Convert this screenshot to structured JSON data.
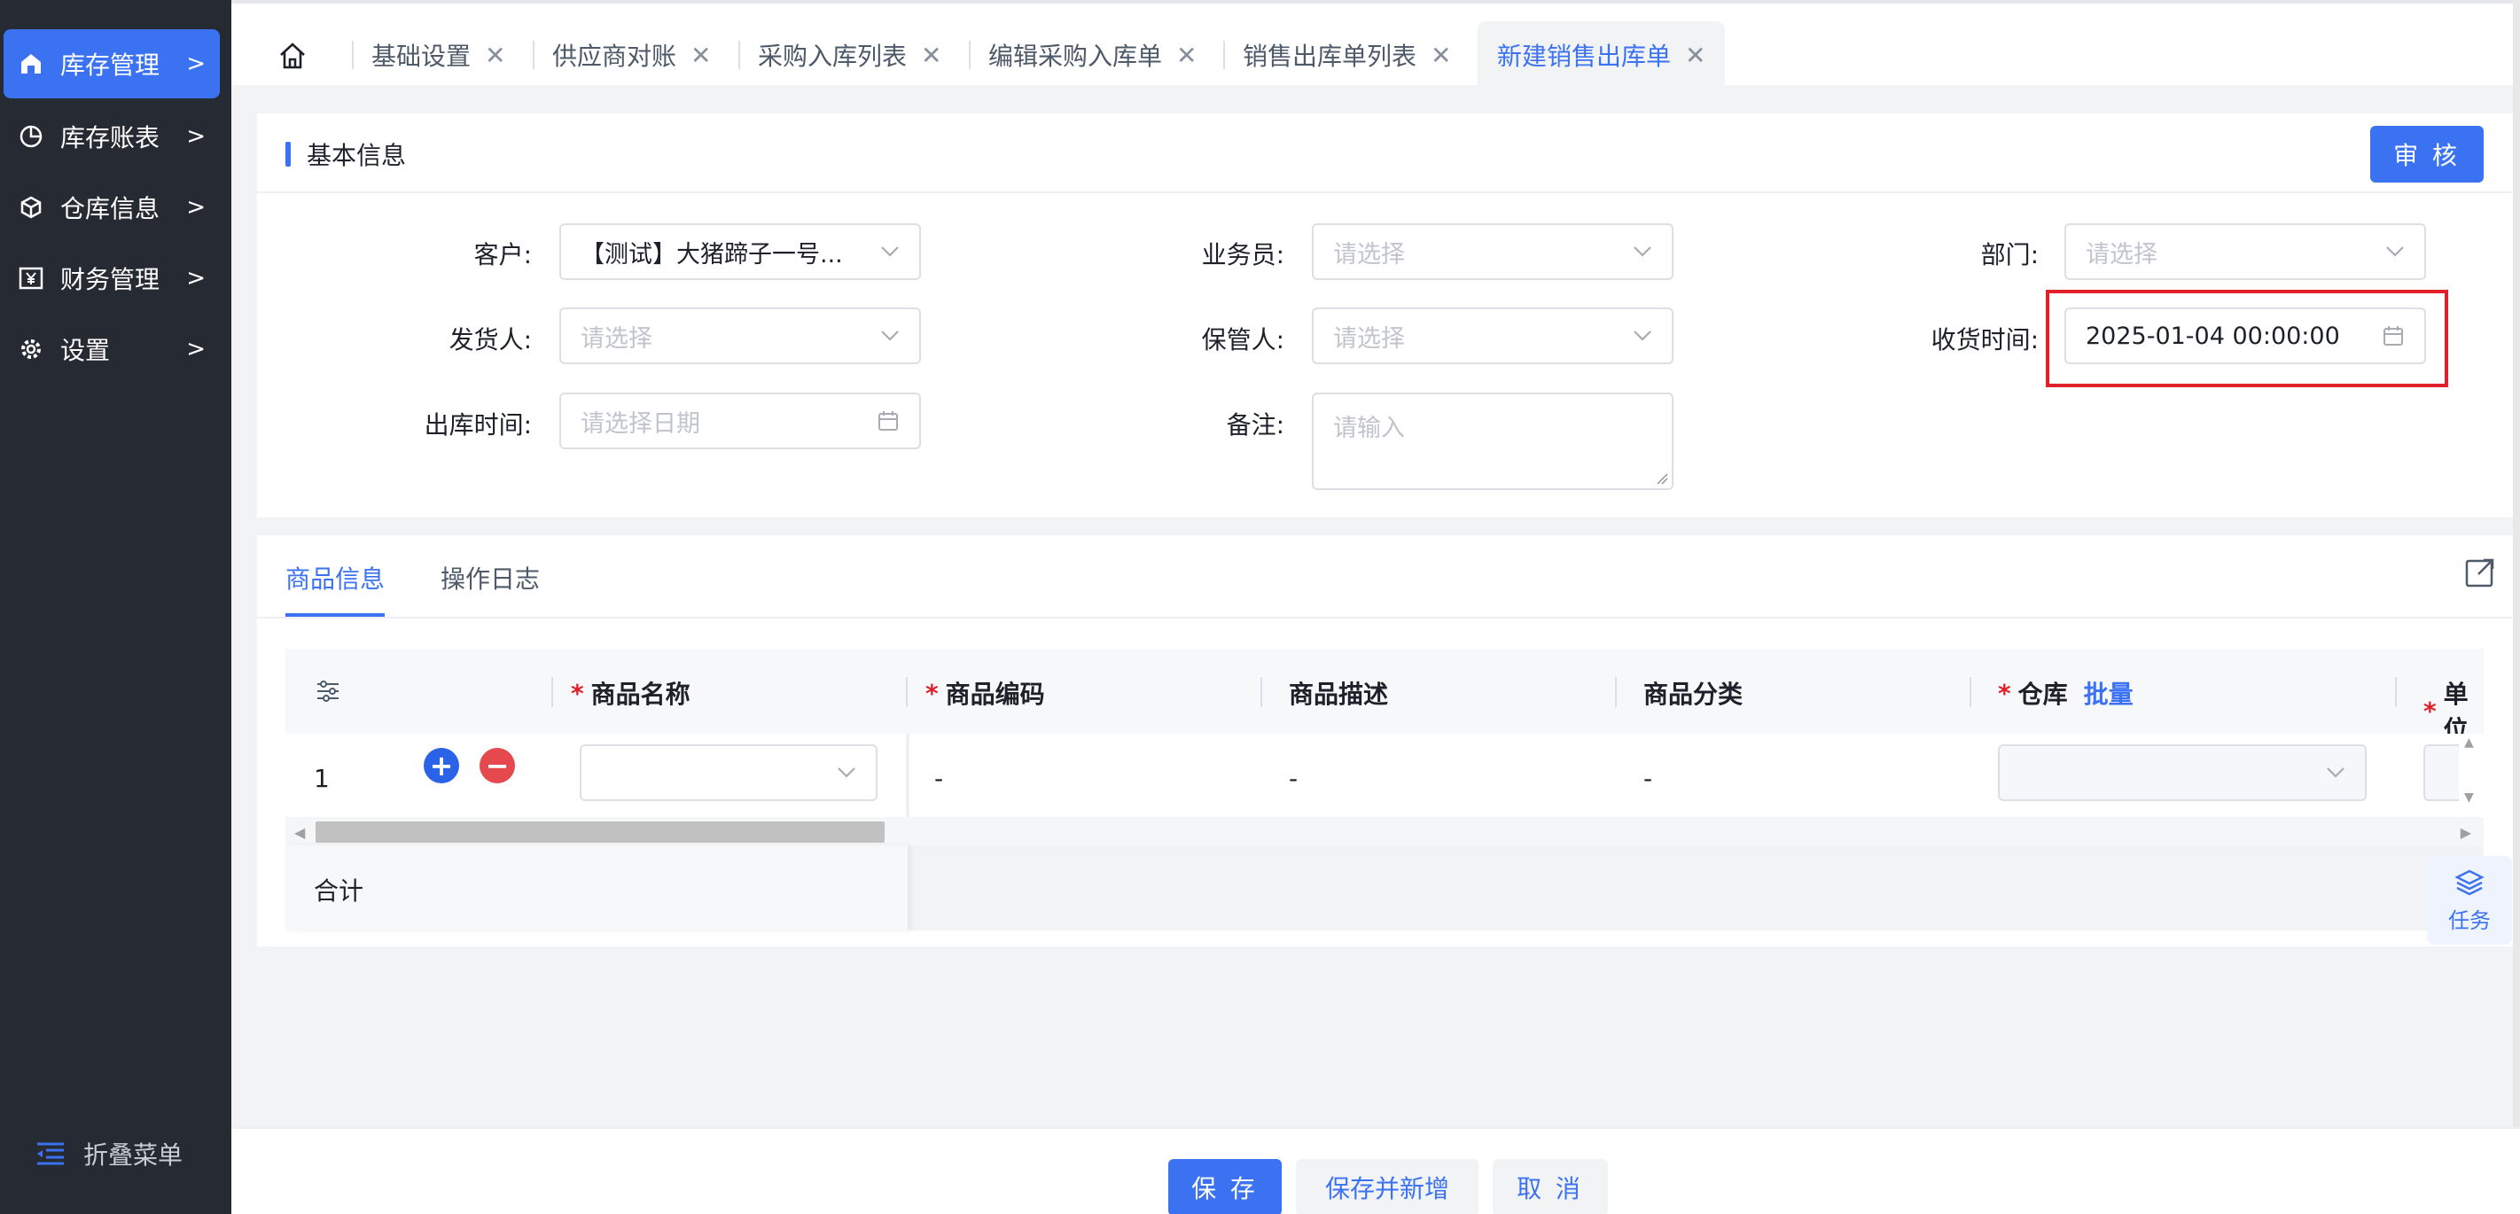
{
  "sidebar": {
    "items": [
      {
        "label": "库存管理",
        "icon": "warehouse-home-icon",
        "active": true
      },
      {
        "label": "库存账表",
        "icon": "pie-chart-icon",
        "active": false
      },
      {
        "label": "仓库信息",
        "icon": "cube-icon",
        "active": false
      },
      {
        "label": "财务管理",
        "icon": "yen-icon",
        "active": false
      },
      {
        "label": "设置",
        "icon": "gear-icon",
        "active": false
      }
    ],
    "arrow": ">",
    "collapse_label": "折叠菜单"
  },
  "tabs": {
    "items": [
      {
        "label": "基础设置",
        "active": false
      },
      {
        "label": "供应商对账",
        "active": false
      },
      {
        "label": "采购入库列表",
        "active": false
      },
      {
        "label": "编辑采购入库单",
        "active": false
      },
      {
        "label": "销售出库单列表",
        "active": false
      },
      {
        "label": "新建销售出库单",
        "active": true
      }
    ],
    "close": "✕"
  },
  "basic_info": {
    "title": "基本信息",
    "audit_label": "审 核",
    "fields": {
      "customer": {
        "label": "客户:",
        "value": "【测试】大猪蹄子一号..."
      },
      "salesman": {
        "label": "业务员:",
        "placeholder": "请选择"
      },
      "department": {
        "label": "部门:",
        "placeholder": "请选择"
      },
      "shipper": {
        "label": "发货人:",
        "placeholder": "请选择"
      },
      "keeper": {
        "label": "保管人:",
        "placeholder": "请选择"
      },
      "receive_time": {
        "label": "收货时间:",
        "value": "2025-01-04 00:00:00"
      },
      "outbound_time": {
        "label": "出库时间:",
        "placeholder": "请选择日期"
      },
      "remark": {
        "label": "备注:",
        "placeholder": "请输入"
      }
    }
  },
  "goods": {
    "tabs": [
      {
        "label": "商品信息",
        "active": true
      },
      {
        "label": "操作日志",
        "active": false
      }
    ],
    "columns": {
      "name": "商品名称",
      "code": "商品编码",
      "desc": "商品描述",
      "category": "商品分类",
      "warehouse": "仓库",
      "batch": "批量",
      "unit": "单位"
    },
    "required_mark": "*",
    "rows": [
      {
        "index": "1",
        "code": "-",
        "desc": "-",
        "category": "-"
      }
    ],
    "add": "+",
    "remove": "−",
    "total_label": "合计",
    "task_label": "任务"
  },
  "footer": {
    "save": "保 存",
    "save_new": "保存并新增",
    "cancel": "取 消"
  },
  "colors": {
    "primary": "#3b72f2",
    "sidebar_bg": "#262a33",
    "danger": "#e5484d",
    "highlight": "#e0202a"
  }
}
